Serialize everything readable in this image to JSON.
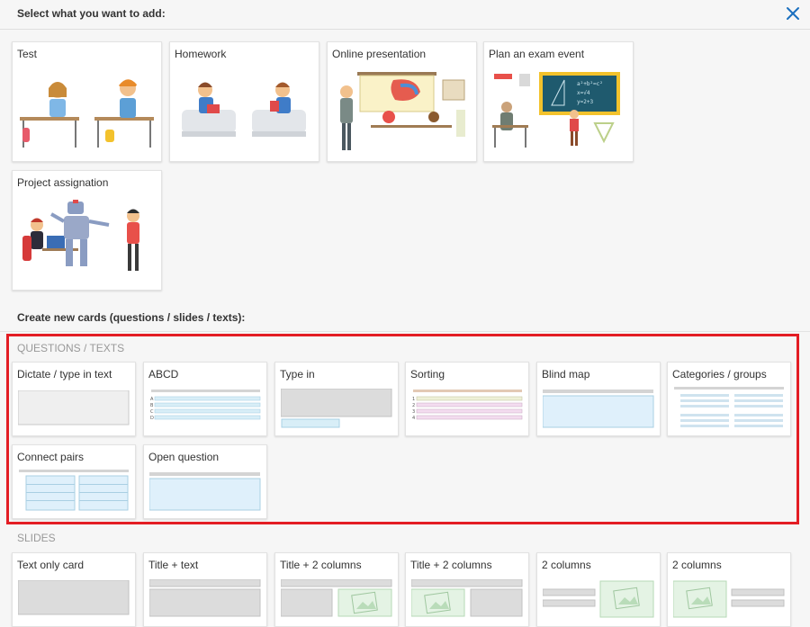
{
  "header": {
    "title": "Select what you want to add:",
    "close_icon": "close-icon"
  },
  "activities": [
    {
      "label": "Test"
    },
    {
      "label": "Homework"
    },
    {
      "label": "Online presentation"
    },
    {
      "label": "Plan an exam event"
    },
    {
      "label": "Project assignation"
    }
  ],
  "cards_section": {
    "title": "Create new cards (questions / slides / texts):"
  },
  "questions": {
    "title": "QUESTIONS / TEXTS",
    "items": [
      {
        "label": "Dictate / type in text"
      },
      {
        "label": "ABCD"
      },
      {
        "label": "Type in"
      },
      {
        "label": "Sorting"
      },
      {
        "label": "Blind map"
      },
      {
        "label": "Categories / groups"
      },
      {
        "label": "Connect pairs"
      },
      {
        "label": "Open question"
      }
    ],
    "abcd_letters": [
      "A",
      "B",
      "C",
      "D"
    ],
    "sorting_numbers": [
      "1",
      "2",
      "3",
      "4"
    ]
  },
  "slides": {
    "title": "SLIDES",
    "items": [
      {
        "label": "Text only card"
      },
      {
        "label": "Title + text"
      },
      {
        "label": "Title + 2 columns"
      },
      {
        "label": "Title + 2 columns"
      },
      {
        "label": "2 columns"
      },
      {
        "label": "2 columns"
      }
    ]
  },
  "colors": {
    "highlight": "#e31d24",
    "accent": "#1a6fbf"
  }
}
